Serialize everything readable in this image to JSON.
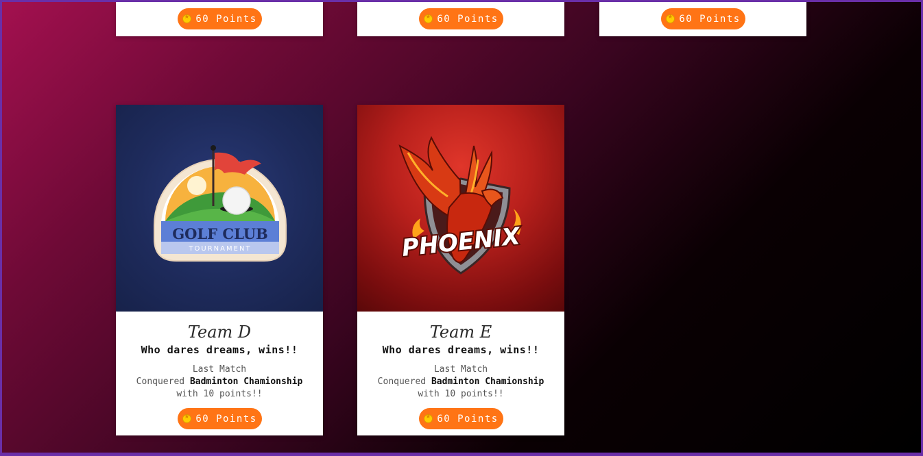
{
  "top_cards": [
    {
      "points_label": "60 Points"
    },
    {
      "points_label": "60 Points"
    },
    {
      "points_label": "60 Points"
    }
  ],
  "teams": [
    {
      "name": "Team D",
      "motto": "Who dares dreams, wins!!",
      "last_match_label": "Last Match",
      "conquered_prefix": "Conquered",
      "event": "Badminton Chamionship",
      "points_line": "with 10 points!!",
      "points_label": "60 Points",
      "logo": {
        "title": "GOLF CLUB",
        "subtitle": "TOURNAMENT"
      }
    },
    {
      "name": "Team E",
      "motto": "Who dares dreams, wins!!",
      "last_match_label": "Last Match",
      "conquered_prefix": "Conquered",
      "event": "Badminton Chamionship",
      "points_line": "with 10 points!!",
      "points_label": "60 Points",
      "logo": {
        "title": "PHOENIX"
      }
    }
  ],
  "colors": {
    "button": "#ff7415",
    "coin": "#ffcc00",
    "frame": "#6a2fa8"
  },
  "icons": {
    "coin": "coin-icon"
  }
}
